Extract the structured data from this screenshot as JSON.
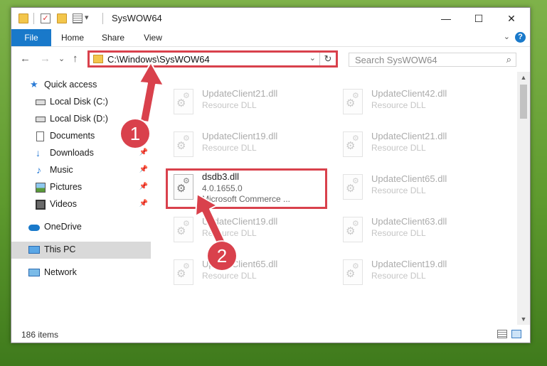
{
  "window": {
    "title": "SysWOW64",
    "qat_dropdown": "▾"
  },
  "window_controls": {
    "minimize": "—",
    "maximize": "☐",
    "close": "✕"
  },
  "ribbon": {
    "tabs": [
      "File",
      "Home",
      "Share",
      "View"
    ],
    "collapse": "⌄",
    "help": "?"
  },
  "address": {
    "path": "C:\\Windows\\SysWOW64",
    "dropdown": "⌄",
    "refresh": "↻"
  },
  "nav_buttons": {
    "back": "←",
    "forward": "→",
    "recent": "⌄",
    "up": "↑"
  },
  "search": {
    "placeholder": "Search SysWOW64",
    "icon": "⌕"
  },
  "navpane": {
    "items": [
      {
        "label": "Quick access",
        "icon": "star-icon",
        "pinned": false
      },
      {
        "label": "Local Disk (C:)",
        "icon": "drive-icon",
        "pinned": false
      },
      {
        "label": "Local Disk (D:)",
        "icon": "drive-icon",
        "pinned": false
      },
      {
        "label": "Documents",
        "icon": "documents-icon",
        "pinned": false
      },
      {
        "label": "Downloads",
        "icon": "download-icon",
        "pinned": true
      },
      {
        "label": "Music",
        "icon": "music-icon",
        "pinned": true
      },
      {
        "label": "Pictures",
        "icon": "pictures-icon",
        "pinned": true
      },
      {
        "label": "Videos",
        "icon": "videos-icon",
        "pinned": true
      },
      {
        "label": "OneDrive",
        "icon": "cloud-icon",
        "pinned": false
      },
      {
        "label": "This PC",
        "icon": "computer-icon",
        "pinned": false,
        "selected": true
      },
      {
        "label": "Network",
        "icon": "network-icon",
        "pinned": false
      }
    ],
    "pin_glyph": "📌"
  },
  "files": [
    {
      "name": "UpdateClient21.dll",
      "type": "Resource DLL"
    },
    {
      "name": "UpdateClient42.dll",
      "type": "Resource DLL"
    },
    {
      "name": "UpdateClient19.dll",
      "type": "Resource DLL"
    },
    {
      "name": "UpdateClient21.dll",
      "type": "Resource DLL"
    },
    {
      "name": "dsdb3.dll",
      "version": "4.0.1655.0",
      "company": "Microsoft Commerce ...",
      "highlighted": true
    },
    {
      "name": "UpdateClient65.dll",
      "type": "Resource DLL"
    },
    {
      "name": "UpdateClient19.dll",
      "type": "Resource DLL"
    },
    {
      "name": "UpdateClient63.dll",
      "type": "Resource DLL"
    },
    {
      "name": "UpdateClient65.dll",
      "type": "Resource DLL"
    },
    {
      "name": "UpdateClient19.dll",
      "type": "Resource DLL"
    }
  ],
  "status": {
    "item_count": "186 items"
  },
  "annotations": {
    "step1": "1",
    "step2": "2",
    "color": "#d9414c"
  },
  "colors": {
    "accent": "#1979ca",
    "highlight": "#d9414c",
    "selected_nav": "#d9d9d9"
  }
}
